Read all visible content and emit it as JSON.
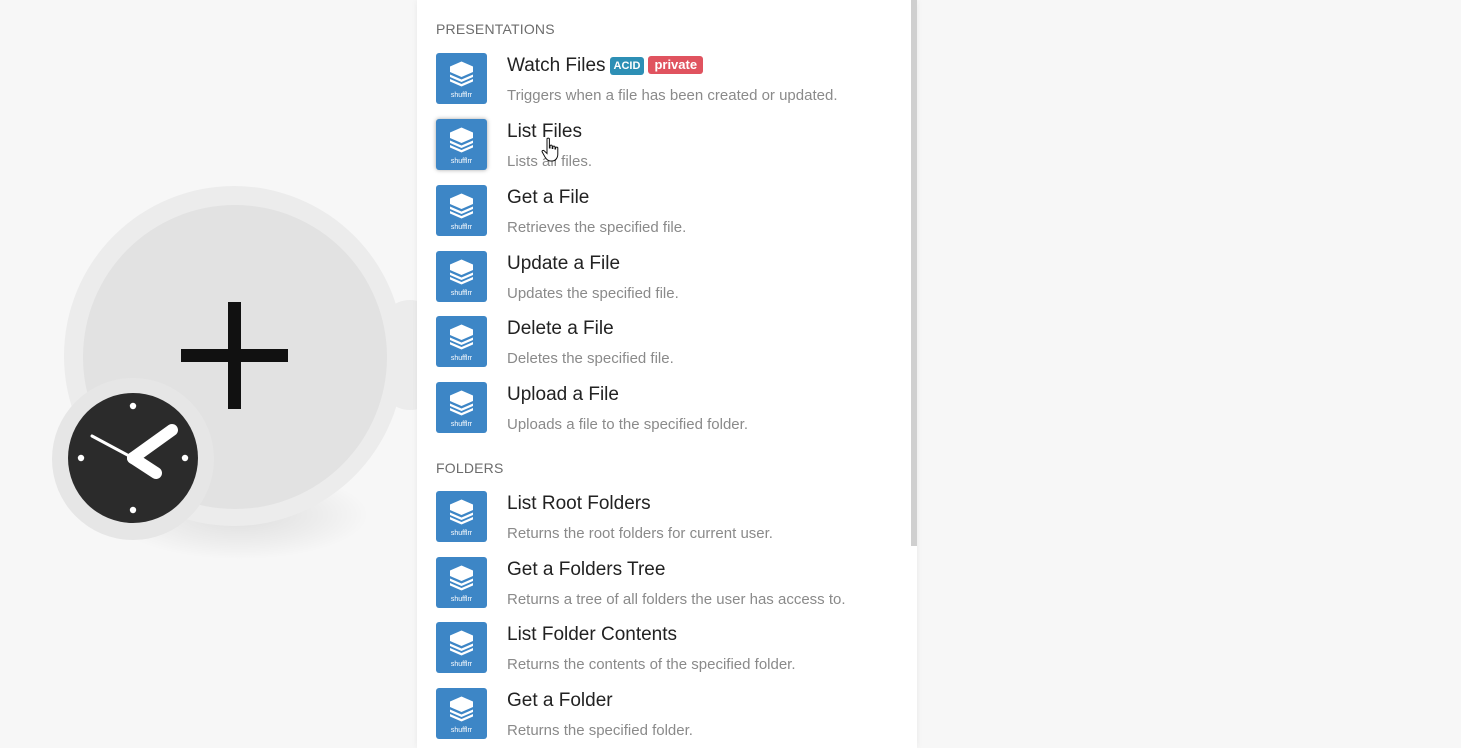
{
  "colors": {
    "app_icon_bg": "#3d86c6",
    "badge_acid": "#2d8fb5",
    "badge_private": "#e0535f",
    "canvas_bg": "#f7f7f7"
  },
  "module": {
    "add_icon": "plus-icon",
    "trigger_icon": "clock-icon"
  },
  "sections": [
    {
      "header": "PRESENTATIONS",
      "items": [
        {
          "title": "Watch Files",
          "description": "Triggers when a file has been created or updated.",
          "badges": [
            "ACID",
            "private"
          ]
        },
        {
          "title": "List Files",
          "description": "Lists all files."
        },
        {
          "title": "Get a File",
          "description": "Retrieves the specified file."
        },
        {
          "title": "Update a File",
          "description": "Updates the specified file."
        },
        {
          "title": "Delete a File",
          "description": "Deletes the specified file."
        },
        {
          "title": "Upload a File",
          "description": "Uploads a file to the specified folder."
        }
      ]
    },
    {
      "header": "FOLDERS",
      "items": [
        {
          "title": "List Root Folders",
          "description": "Returns the root folders for current user."
        },
        {
          "title": "Get a Folders Tree",
          "description": "Returns a tree of all folders the user has access to."
        },
        {
          "title": "List Folder Contents",
          "description": "Returns the contents of the specified folder."
        },
        {
          "title": "Get a Folder",
          "description": "Returns the specified folder."
        }
      ]
    }
  ],
  "app_icon_label": "shufflrr"
}
